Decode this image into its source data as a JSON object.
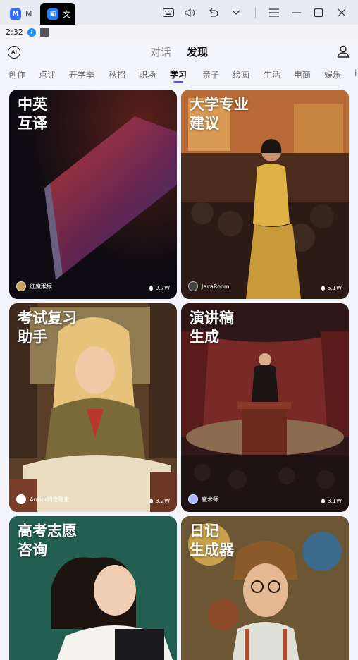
{
  "titlebar": {
    "tabs": [
      {
        "icon": "M",
        "label": "M",
        "color": "#2f6bff"
      },
      {
        "icon": "app",
        "label": "文",
        "color": "#1b7cff"
      }
    ],
    "icons": [
      "keyboard-icon",
      "volume-icon",
      "undo-icon",
      "chevron-down-icon",
      "menu-icon",
      "minimize-icon",
      "maximize-icon",
      "close-icon"
    ]
  },
  "statusbar": {
    "time": "2:32"
  },
  "header": {
    "ai_label": "AI",
    "tabs": [
      "对话",
      "发现"
    ],
    "active_tab": "发现"
  },
  "categories": [
    "创作",
    "点评",
    "开学季",
    "秋招",
    "职场",
    "学习",
    "亲子",
    "绘画",
    "生活",
    "电商",
    "娱乐",
    "i"
  ],
  "active_category": "学习",
  "cards": [
    {
      "title": "中英\n互译",
      "author": "红魔猴猴",
      "stat": "9.7W"
    },
    {
      "title": "大学专业\n建议",
      "author": "JavaRoom",
      "stat": "5.1W"
    },
    {
      "title": "考试复习\n助手",
      "author": "Armor的整理室",
      "stat": "3.2W"
    },
    {
      "title": "演讲稿\n生成",
      "author": "魔术师",
      "stat": "3.1W"
    },
    {
      "title": "高考志愿\n咨询",
      "author": "",
      "stat": ""
    },
    {
      "title": "日记\n生成器",
      "author": "",
      "stat": ""
    }
  ]
}
